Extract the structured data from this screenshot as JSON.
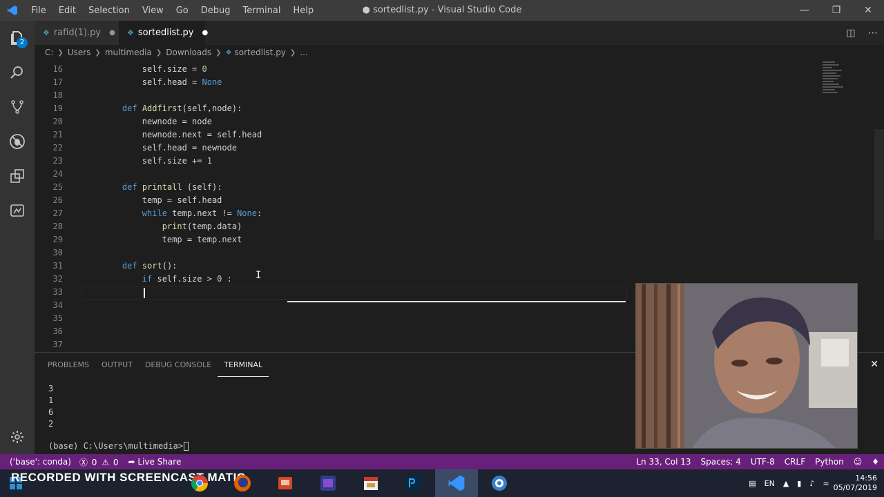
{
  "app": {
    "title": "● sortedlist.py - Visual Studio Code",
    "menu": [
      "File",
      "Edit",
      "Selection",
      "View",
      "Go",
      "Debug",
      "Terminal",
      "Help"
    ]
  },
  "activity": {
    "explorer_badge": "2",
    "icons": [
      "files-icon",
      "search-icon",
      "source-control-icon",
      "debug-icon",
      "extensions-icon",
      "remote-icon"
    ]
  },
  "tabs": [
    {
      "label": "rafid(1).py",
      "dirty": "●"
    },
    {
      "label": "sortedlist.py",
      "dirty": "●"
    }
  ],
  "breadcrumb": {
    "parts": [
      "C:",
      "Users",
      "multimedia",
      "Downloads",
      "sortedlist.py",
      "..."
    ]
  },
  "editor": {
    "lines": [
      {
        "n": "16",
        "code": "        self.size = 0"
      },
      {
        "n": "17",
        "code": "        self.head = None"
      },
      {
        "n": "18",
        "code": ""
      },
      {
        "n": "19",
        "code": "    def Addfirst(self,node):"
      },
      {
        "n": "20",
        "code": "        newnode = node"
      },
      {
        "n": "21",
        "code": "        newnode.next = self.head"
      },
      {
        "n": "22",
        "code": "        self.head = newnode"
      },
      {
        "n": "23",
        "code": "        self.size += 1"
      },
      {
        "n": "24",
        "code": ""
      },
      {
        "n": "25",
        "code": "    def printall (self):"
      },
      {
        "n": "26",
        "code": "        temp = self.head"
      },
      {
        "n": "27",
        "code": "        while temp.next != None:"
      },
      {
        "n": "28",
        "code": "            print(temp.data)"
      },
      {
        "n": "29",
        "code": "            temp = temp.next"
      },
      {
        "n": "30",
        "code": ""
      },
      {
        "n": "31",
        "code": "    def sort():"
      },
      {
        "n": "32",
        "code": "        if self.size > 0 :"
      },
      {
        "n": "33",
        "code": ""
      },
      {
        "n": "34",
        "code": ""
      },
      {
        "n": "35",
        "code": ""
      },
      {
        "n": "36",
        "code": ""
      },
      {
        "n": "37",
        "code": ""
      }
    ]
  },
  "panel": {
    "tabs": [
      "PROBLEMS",
      "OUTPUT",
      "DEBUG CONSOLE",
      "TERMINAL"
    ],
    "active_tab": "TERMINAL",
    "output": [
      "3",
      "1",
      "6",
      "2"
    ],
    "prompt": "(base) C:\\Users\\multimedia>"
  },
  "status": {
    "env": "('base': conda)",
    "errors": "0",
    "warnings": "0",
    "live_share": "Live Share",
    "position": "Ln 33, Col 13",
    "spaces": "Spaces: 4",
    "encoding": "UTF-8",
    "eol": "CRLF",
    "language": "Python"
  },
  "taskbar": {
    "watermark": "RECORDED WITH SCREENCAST MATIC",
    "lang": "EN",
    "time": "14:56",
    "date": "05/07/2019"
  },
  "colors": {
    "statusbar": "#68217a",
    "keyword": "#569cd6",
    "function": "#dcdcaa",
    "number": "#b5cea8"
  }
}
